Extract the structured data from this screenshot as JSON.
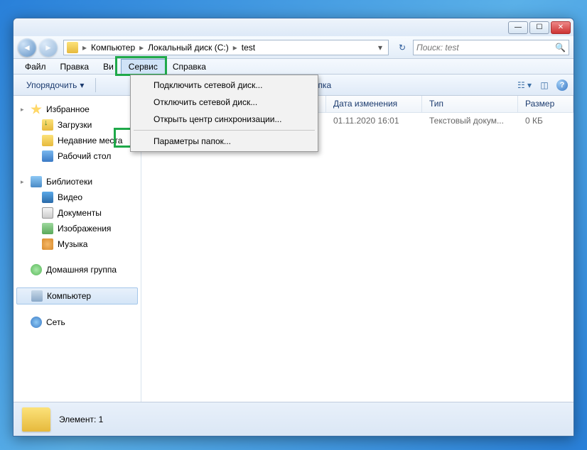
{
  "titlebar": {
    "min": "—",
    "max": "☐",
    "close": "✕"
  },
  "breadcrumb": {
    "items": [
      "Компьютер",
      "Локальный диск (C:)",
      "test"
    ]
  },
  "search": {
    "placeholder": "Поиск: test"
  },
  "menubar": {
    "file": "Файл",
    "edit": "Правка",
    "view_truncated": "Ви",
    "tools": "Сервис",
    "help": "Справка"
  },
  "dropdown": {
    "map_drive": "Подключить сетевой диск...",
    "disconnect_drive": "Отключить сетевой диск...",
    "sync_center": "Открыть центр синхронизации...",
    "folder_options": "Параметры папок..."
  },
  "toolbar": {
    "organize": "Упорядочить",
    "new_folder": "Новая папка"
  },
  "sidebar": {
    "favorites": "Избранное",
    "downloads": "Загрузки",
    "recent": "Недавние места",
    "desktop": "Рабочий стол",
    "libraries": "Библиотеки",
    "videos": "Видео",
    "documents": "Документы",
    "pictures": "Изображения",
    "music": "Музыка",
    "homegroup": "Домашняя группа",
    "computer": "Компьютер",
    "network": "Сеть"
  },
  "columns": {
    "date": "Дата изменения",
    "type": "Тип",
    "size": "Размер"
  },
  "files": [
    {
      "name": "",
      "date": "01.11.2020 16:01",
      "type": "Текстовый докум...",
      "size": "0 КБ"
    }
  ],
  "status": {
    "label": "Элемент: 1"
  }
}
